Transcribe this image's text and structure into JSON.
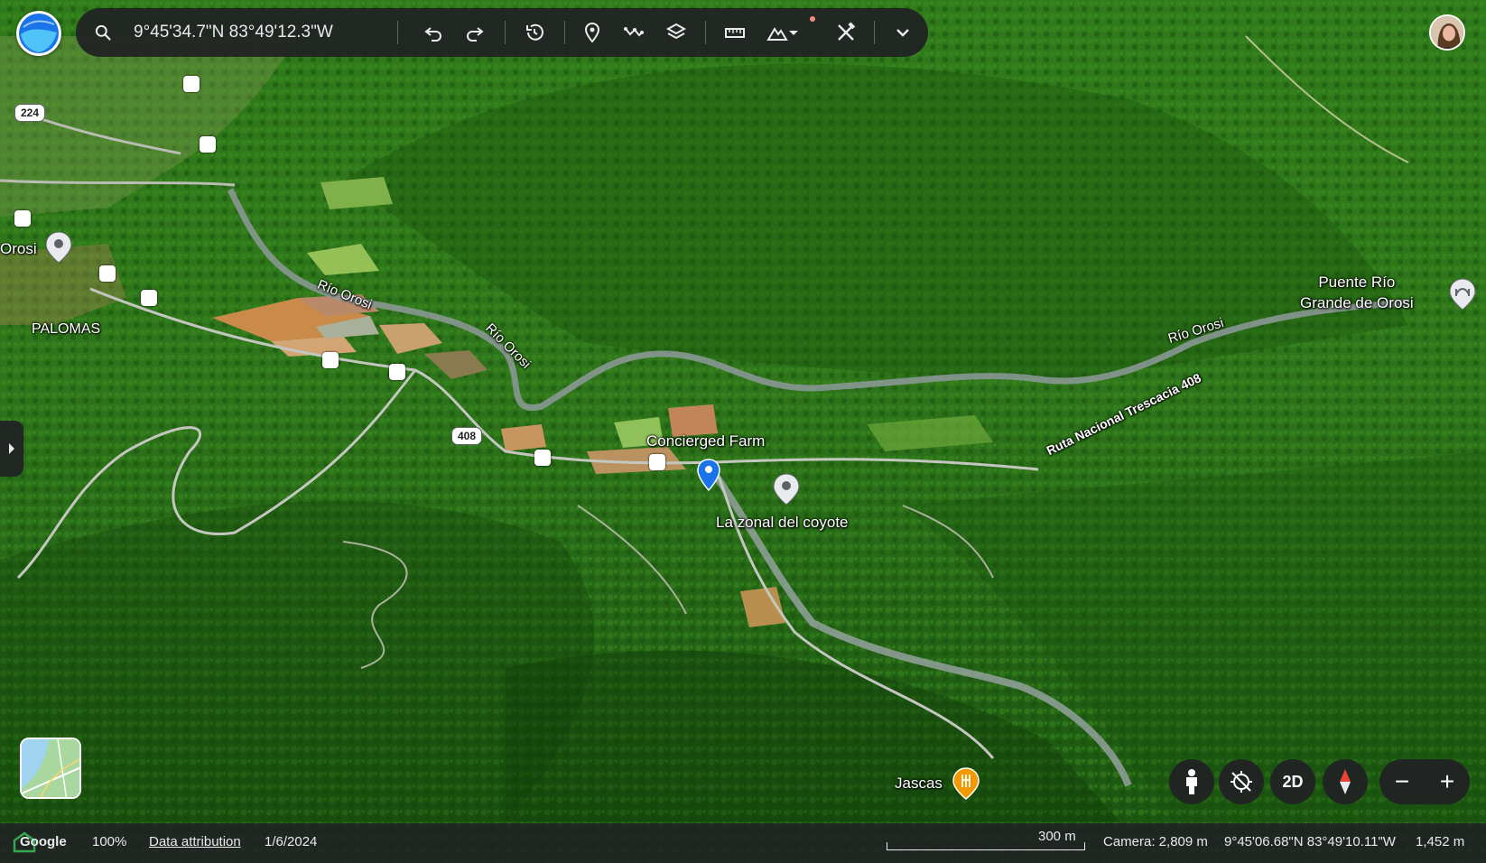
{
  "search": {
    "value": "9°45'34.7\"N 83°49'12.3\"W",
    "icon": "search-icon"
  },
  "toolbar": {
    "undo": "undo-icon",
    "redo": "redo-icon",
    "history": "history-icon",
    "placemark": "placemark-icon",
    "path": "path-icon",
    "layers": "layers-icon",
    "measure": "ruler-icon",
    "terrain": "mountain-icon",
    "tools": "tools-icon",
    "more": "chevron-down-icon"
  },
  "map": {
    "places": {
      "orosi": "Orosi",
      "palomas": "PALOMAS",
      "puente": "Puente Río\nGrande de Orosi",
      "farm": "Concierged Farm",
      "coyote": "La zonal del coyote",
      "jascas": "Jascas"
    },
    "rivers": {
      "r1": "Río Orosi",
      "r2": "Río Orosi",
      "r3": "Río Orosi"
    },
    "roads": {
      "route": "Ruta Nacional Trescacia 408",
      "badge224": "224",
      "badge408": "408"
    }
  },
  "controls": {
    "view2d": "2D",
    "zoom_out": "−",
    "zoom_in": "+"
  },
  "status": {
    "logo": "Google",
    "zoom": "100%",
    "attribution": "Data attribution",
    "date": "1/6/2024",
    "scale": "300 m",
    "camera": "Camera: 2,809 m",
    "coords": "9°45'06.68\"N 83°49'10.11\"W",
    "elevation": "1,452 m"
  },
  "colors": {
    "accent": "#1a73e8",
    "poi_orange": "#f29900",
    "panel": "#202124"
  }
}
